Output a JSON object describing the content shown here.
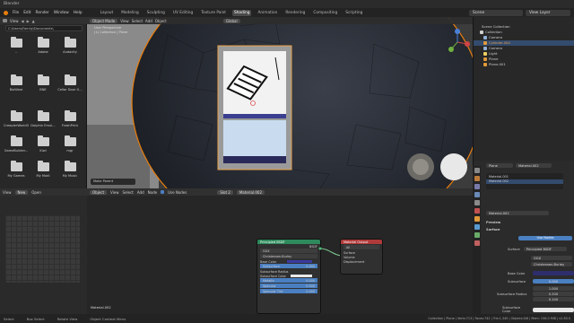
{
  "title": "Blender",
  "menubar": {
    "menus": [
      "File",
      "Edit",
      "Render",
      "Window",
      "Help"
    ],
    "workspaces": [
      "Layout",
      "Modeling",
      "Sculpting",
      "UV Editing",
      "Texture Paint",
      "Shading",
      "Animation",
      "Rendering",
      "Compositing",
      "Scripting"
    ],
    "active_workspace": "Shading",
    "scene_label": "Scene",
    "view_layer_label": "View Layer"
  },
  "filebrowser": {
    "view_label": "View",
    "path": "C:\\Users\\Family\\Documents\\",
    "folders": [
      "..",
      "Adobe",
      "Audacity",
      "BioWare",
      "BNE",
      "Cellar Door G...",
      "CreepierWorld3",
      "Dolphin Emul...",
      "FrashPrint",
      "GameBuilder...",
      "Kiwi",
      "mgr",
      "My Games",
      "My Modi",
      "My Music"
    ]
  },
  "viewport": {
    "mode": "Object Mode",
    "menus": [
      "View",
      "Select",
      "Add",
      "Object"
    ],
    "orientation": "Global",
    "overlay_text_1": "User Perspective",
    "overlay_text_2": "(1) Collection | Plane",
    "operator_panel": "Make Parent"
  },
  "outliner": {
    "title": "Scene Collection",
    "items": [
      {
        "label": "Scene Collection",
        "color": "#cfcfcf"
      },
      {
        "label": "Collection",
        "color": "#cfcfcf"
      },
      {
        "label": "Camera",
        "color": "#8fb0d8"
      },
      {
        "label": "Cylinder.004",
        "color": "#e09a3a"
      },
      {
        "label": "Camera",
        "color": "#8fb0d8"
      },
      {
        "label": "Light",
        "color": "#f0d060"
      },
      {
        "label": "Plane",
        "color": "#e09a3a"
      },
      {
        "label": "Plane.001",
        "color": "#e09a3a"
      }
    ]
  },
  "properties": {
    "object": "Plane",
    "material_header": "Material.002",
    "slots": [
      "Material.001",
      "Material.002"
    ],
    "material_name": "Material.002",
    "preview_label": "Preview",
    "surface_label": "Surface",
    "use_nodes_label": "Use Nodes",
    "surface_field_label": "Surface",
    "surface_value": "Principled BSDF",
    "ggx_value": "GGX",
    "subsurface_method": "Christensen-Burley",
    "base_color_label": "Base Color",
    "subsurface_label": "Subsurface",
    "subsurface_value": "0.000",
    "subsurface_radius_label": "Subsurface Radius",
    "radius_values": [
      "1.000",
      "0.200",
      "0.100"
    ],
    "subsurface_color_label": "Subsurface Color"
  },
  "node_editor": {
    "object_label": "Object",
    "menus": [
      "View",
      "Select",
      "Add",
      "Node"
    ],
    "use_nodes_label": "Use Nodes",
    "slot_label": "Slot 2",
    "material_label": "Material.002",
    "footer_label": "Material.002",
    "bsdf_node": {
      "title": "Principled BSDF",
      "output": "BSDF",
      "rows": [
        "GGX",
        "Christensen-Burley",
        "Base Color",
        "Subsurface",
        "Subsurface Radius",
        "Subsurface Color",
        "Metallic",
        "Specular",
        "Specular Tint"
      ],
      "values": {
        "Subsurface": "0.000",
        "Metallic": "0.000",
        "Specular": "0.500",
        "Specular Tint": "0.000"
      }
    },
    "output_node": {
      "title": "Material Output",
      "target": "All",
      "rows": [
        "Surface",
        "Volume",
        "Displacement"
      ]
    }
  },
  "image_editor": {
    "view_label": "View",
    "new_label": "New",
    "open_label": "Open"
  },
  "statusbar": {
    "select": "Select",
    "box_select": "Box Select",
    "rotate": "Rotate View",
    "context": "Object Context Menu",
    "stats": "Collection | Plane | Verts:713 | Faces:742 | Tris:1,340 | Objects:0/6 | Mem: 156.0 MiB | v2.83.0"
  },
  "colors": {
    "accent": "#4a7fc1",
    "bsdf_header": "#2e8a5c",
    "output_header": "#b03a3a",
    "selected": "#e08a28"
  }
}
